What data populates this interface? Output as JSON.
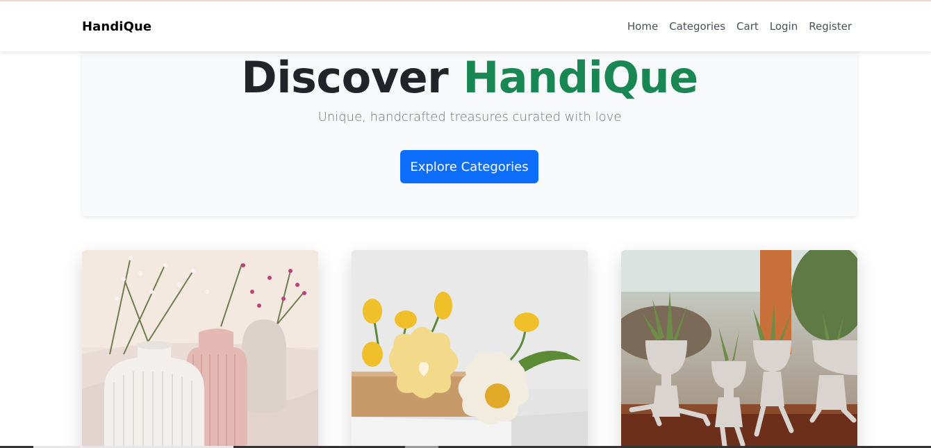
{
  "navbar": {
    "brand": "HandiQue",
    "links": [
      "Home",
      "Categories",
      "Cart",
      "Login",
      "Register"
    ]
  },
  "hero": {
    "title_part1": "Discover",
    "title_part2": "HandiQue",
    "subtitle": "Unique, handcrafted treasures curated with love",
    "cta_label": "Explore Categories"
  },
  "cards": [
    {
      "image": "ribbed-vases-with-dried-flowers"
    },
    {
      "image": "flower-shaped-vases-with-tulips"
    },
    {
      "image": "figure-planters-with-succulents"
    }
  ],
  "colors": {
    "accent": "#198754",
    "primary": "#0d6efd",
    "hero_bg": "#f8f9fa"
  }
}
